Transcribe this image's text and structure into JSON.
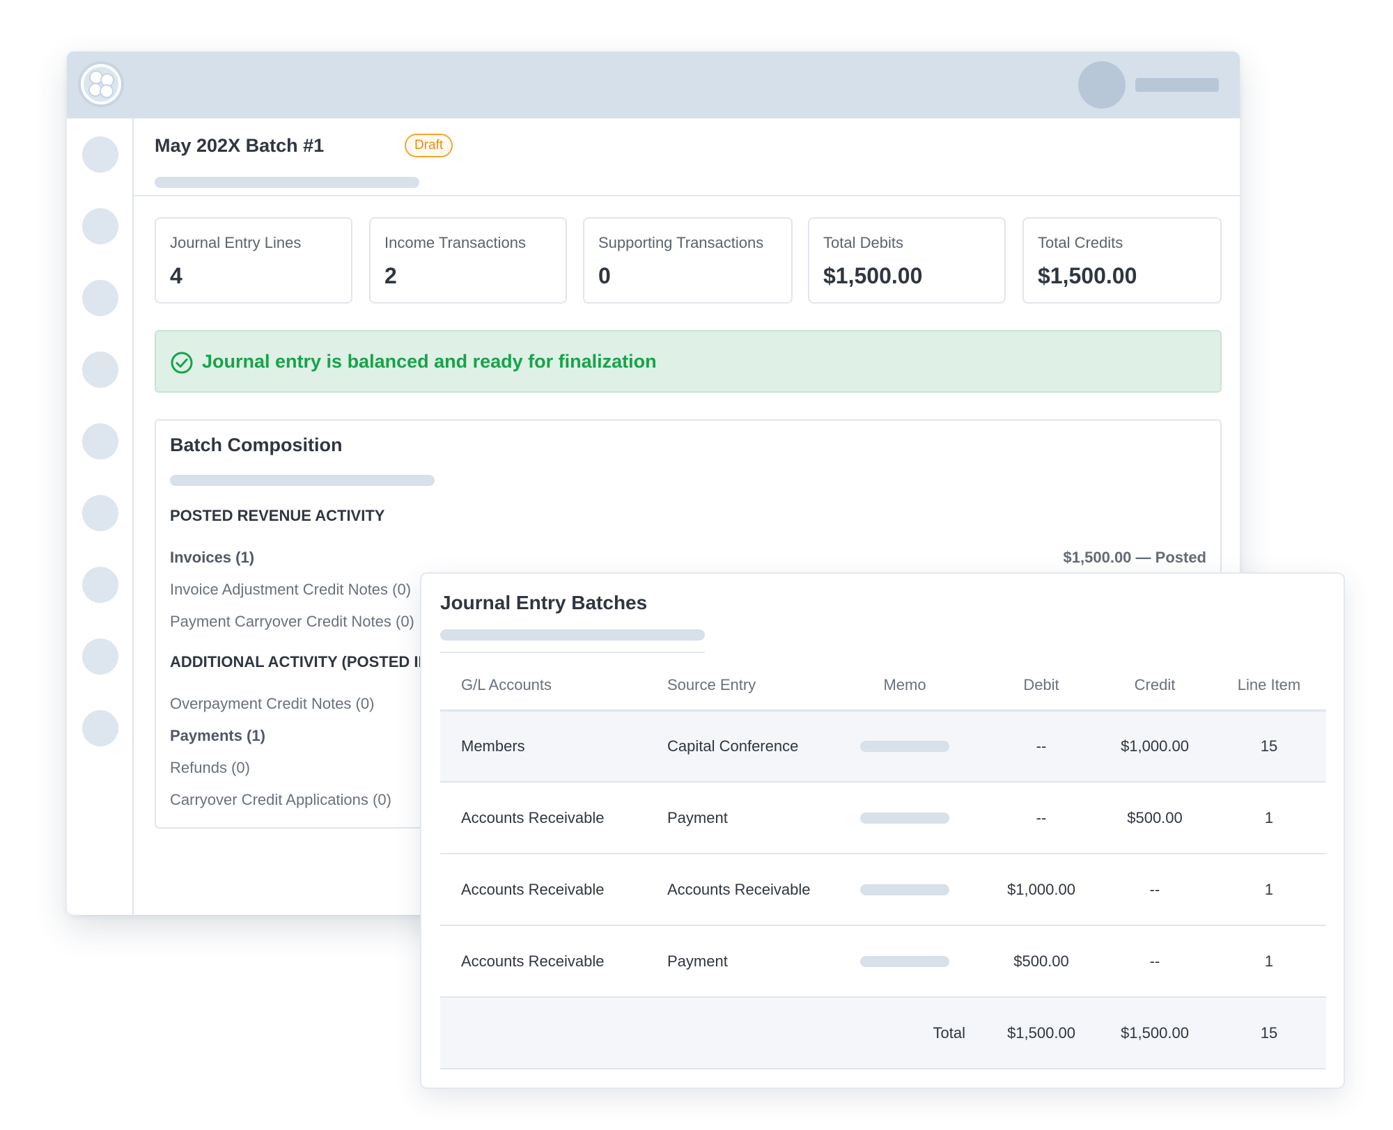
{
  "header": {
    "title": "May 202X Batch #1",
    "status": "Draft"
  },
  "stats": [
    {
      "label": "Journal Entry Lines",
      "value": "4"
    },
    {
      "label": "Income Transactions",
      "value": "2"
    },
    {
      "label": "Supporting Transactions",
      "value": "0"
    },
    {
      "label": "Total Debits",
      "value": "$1,500.00"
    },
    {
      "label": "Total Credits",
      "value": "$1,500.00"
    }
  ],
  "alert": {
    "message": "Journal entry is balanced and ready for finalization",
    "color": "#16a34a"
  },
  "composition": {
    "title": "Batch Composition",
    "posted_revenue_heading": "POSTED REVENUE ACTIVITY",
    "invoices": {
      "label": "Invoices (1)",
      "value": "$1,500.00 — Posted"
    },
    "invoice_adjustment": "Invoice Adjustment Credit Notes (0)",
    "payment_carryover": "Payment Carryover Credit Notes (0)",
    "additional_heading": "ADDITIONAL ACTIVITY (POSTED IN BATCH)",
    "overpayment": "Overpayment Credit Notes (0)",
    "payments": "Payments (1)",
    "refunds": "Refunds (0)",
    "carryover_applications": "Carryover Credit Applications (0)"
  },
  "batches": {
    "title": "Journal Entry Batches",
    "columns": [
      "G/L Accounts",
      "Source Entry",
      "Memo",
      "Debit",
      "Credit",
      "Line Item"
    ],
    "rows": [
      {
        "account": "Members",
        "source": "Capital Conference",
        "debit": "--",
        "credit": "$1,000.00",
        "line_item": "15"
      },
      {
        "account": "Accounts Receivable",
        "source": "Payment",
        "debit": "--",
        "credit": "$500.00",
        "line_item": "1"
      },
      {
        "account": "Accounts Receivable",
        "source": "Accounts Receivable",
        "debit": "$1,000.00",
        "credit": "--",
        "line_item": "1"
      },
      {
        "account": "Accounts Receivable",
        "source": "Payment",
        "debit": "$500.00",
        "credit": "--",
        "line_item": "1"
      }
    ],
    "total": {
      "label": "Total",
      "debit": "$1,500.00",
      "credit": "$1,500.00",
      "line_item": "15"
    }
  },
  "icons": {
    "logo": "app-logo",
    "avatar": "user-avatar",
    "alert": "check-circle-icon"
  },
  "colors": {
    "topbar": "#d5e0ea",
    "draft": "#f08a0c",
    "success_background": "#dff0e6"
  }
}
